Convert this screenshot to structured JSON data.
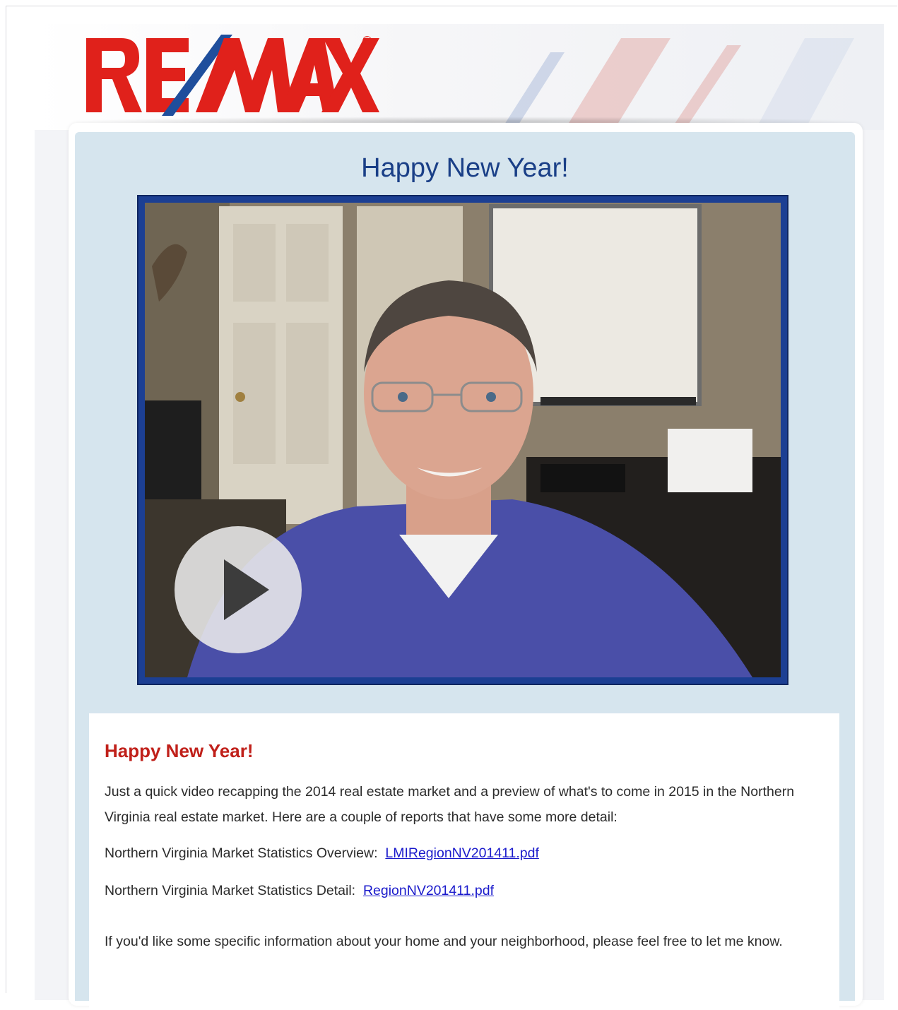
{
  "brand": {
    "logo_text": "RE/MAX",
    "registered_mark": "®",
    "colors": {
      "red": "#e0211b",
      "blue": "#1f4e9c"
    }
  },
  "header": {
    "title": "Happy New Year!"
  },
  "video": {
    "play_icon": "play-icon",
    "border_color": "#1c3f93"
  },
  "message": {
    "title": "Happy New Year!",
    "intro": "Just a quick video recapping the 2014 real estate market and a preview of what's to come in 2015 in the Northern Virginia real estate market.  Here are a couple of reports that have some more detail:",
    "reports": [
      {
        "label": "Northern Virginia Market Statistics Overview:",
        "link_text": "LMIRegionNV201411.pdf"
      },
      {
        "label": "Northern Virginia Market Statistics Detail:",
        "link_text": "RegionNV201411.pdf"
      }
    ],
    "closing": "If you'd like some specific information about your home and your neighborhood, please feel free to let me know."
  }
}
